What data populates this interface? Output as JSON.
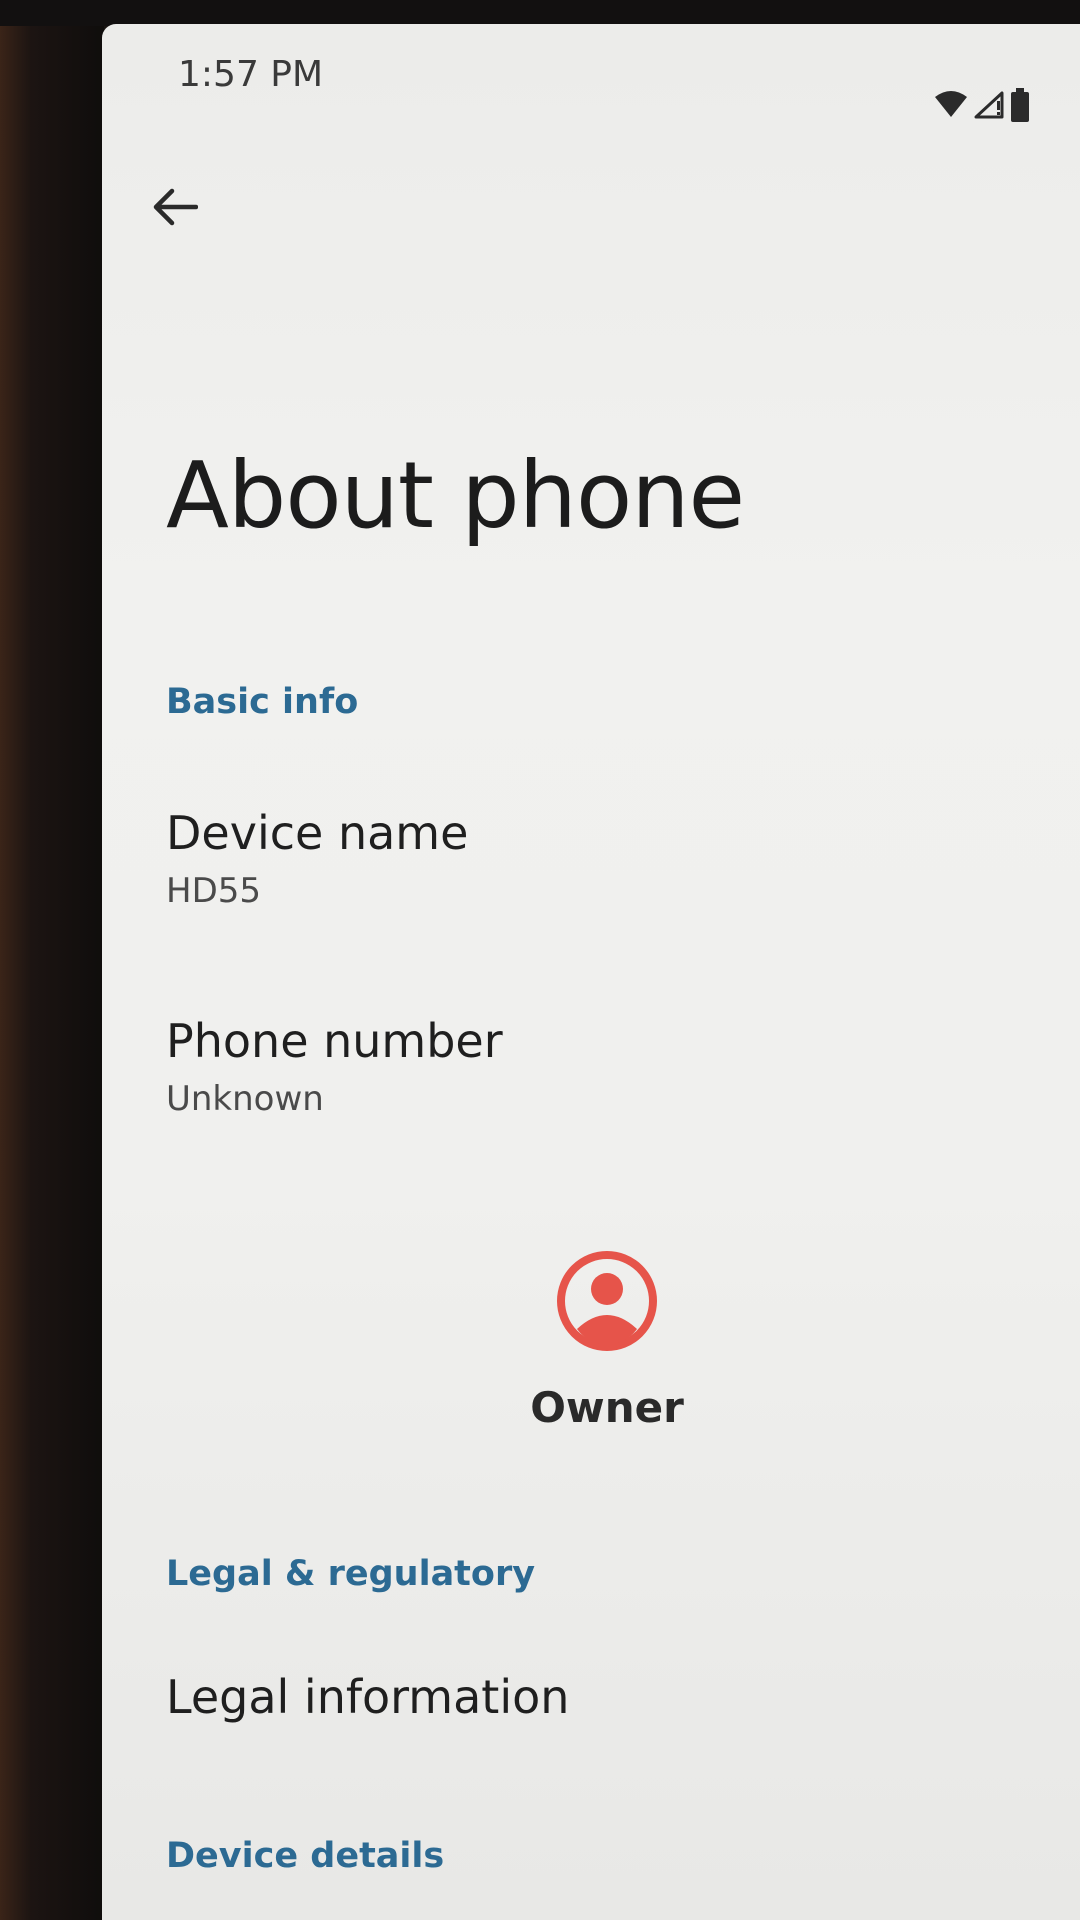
{
  "status_bar": {
    "time": "1:57 PM",
    "icons": [
      "wifi-icon",
      "signal-icon",
      "battery-icon"
    ]
  },
  "nav": {
    "back_icon": "arrow-back-icon"
  },
  "page": {
    "title": "About phone"
  },
  "sections": {
    "basic_info": {
      "header": "Basic info",
      "device_name": {
        "title": "Device name",
        "value": "HD55"
      },
      "phone_number": {
        "title": "Phone number",
        "value": "Unknown"
      }
    },
    "owner": {
      "label": "Owner",
      "icon": "account-circle-icon",
      "color": "#e6544a"
    },
    "legal": {
      "header": "Legal & regulatory",
      "legal_information": {
        "title": "Legal information"
      }
    },
    "device_details": {
      "header": "Device details"
    }
  },
  "colors": {
    "accent": "#2c6a93",
    "background": "#f0f0ee",
    "text_primary": "#1f1f1f",
    "text_secondary": "#4a4a4a"
  }
}
